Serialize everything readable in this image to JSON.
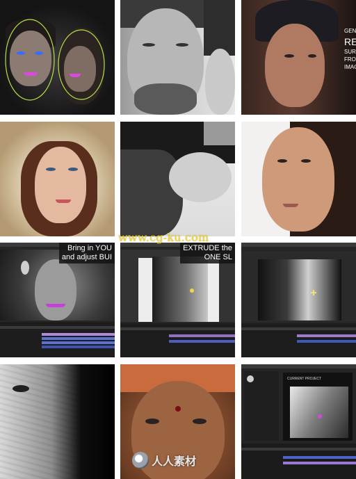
{
  "tiles": {
    "t3": {
      "lines": [
        "GEN",
        "REA",
        "SURF",
        "FROM",
        "IMAG"
      ]
    },
    "t7": {
      "caption": [
        "Bring in YOU",
        "and adjust BUI"
      ]
    },
    "t8": {
      "caption": [
        "EXTRUDE the",
        "ONE SL"
      ]
    },
    "t12": {
      "label": "CURRENT PROJECT"
    }
  },
  "watermark": {
    "text": "www.cg-ku.com"
  },
  "logo": {
    "text": "人人素材",
    "icon": "logo-mark"
  },
  "colors": {
    "watermark": "#f2d21a",
    "ui_dark": "#2b2b2b",
    "mask_green": "#8bc34a",
    "timeline_blue": "#4b63c9",
    "timeline_purple": "#a073d0"
  }
}
